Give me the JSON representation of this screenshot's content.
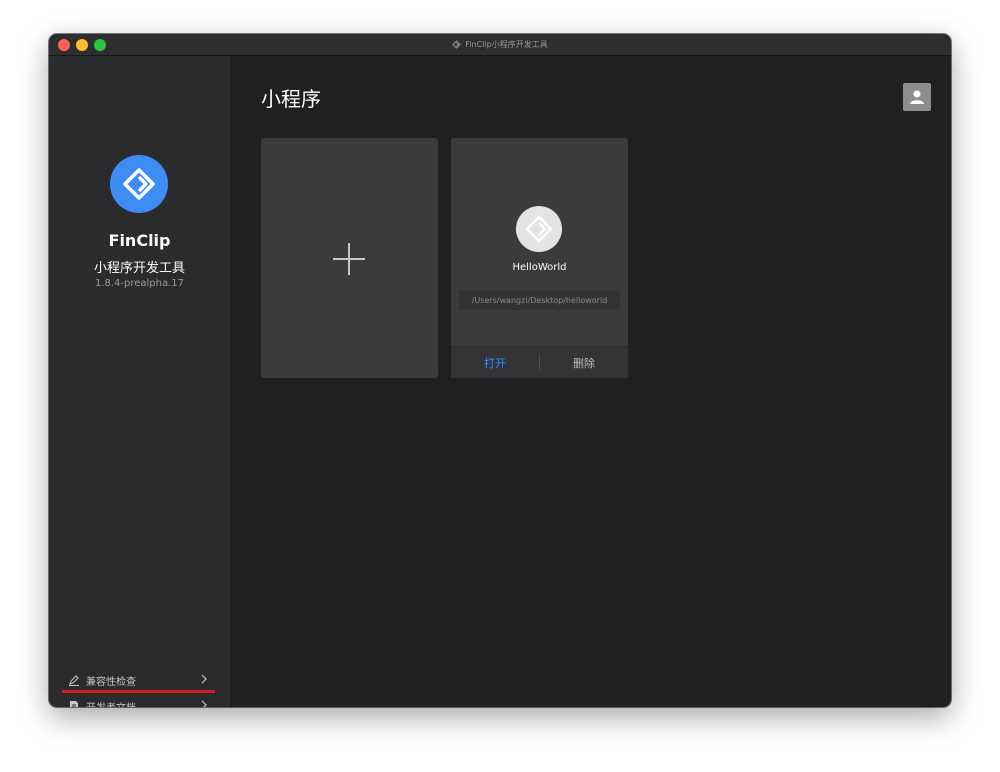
{
  "window": {
    "title": "FinClip小程序开发工具"
  },
  "sidebar": {
    "brand_name": "FinClip",
    "brand_subtitle": "小程序开发工具",
    "version": "1.8.4-prealpha.17",
    "links": [
      {
        "label": "兼容性检查",
        "icon": "pencil-icon"
      },
      {
        "label": "开发者文档",
        "icon": "document-icon"
      }
    ]
  },
  "main": {
    "title": "小程序",
    "projects": [
      {
        "name": "HelloWorld",
        "path": "/Users/wangzi/Desktop/helloworld",
        "open_label": "打开",
        "delete_label": "删除"
      }
    ]
  },
  "colors": {
    "accent": "#3d8df5",
    "annotation": "#d0201e",
    "background": "#202022",
    "sidebar": "#2b2b2d",
    "card": "#3b3b3d"
  }
}
